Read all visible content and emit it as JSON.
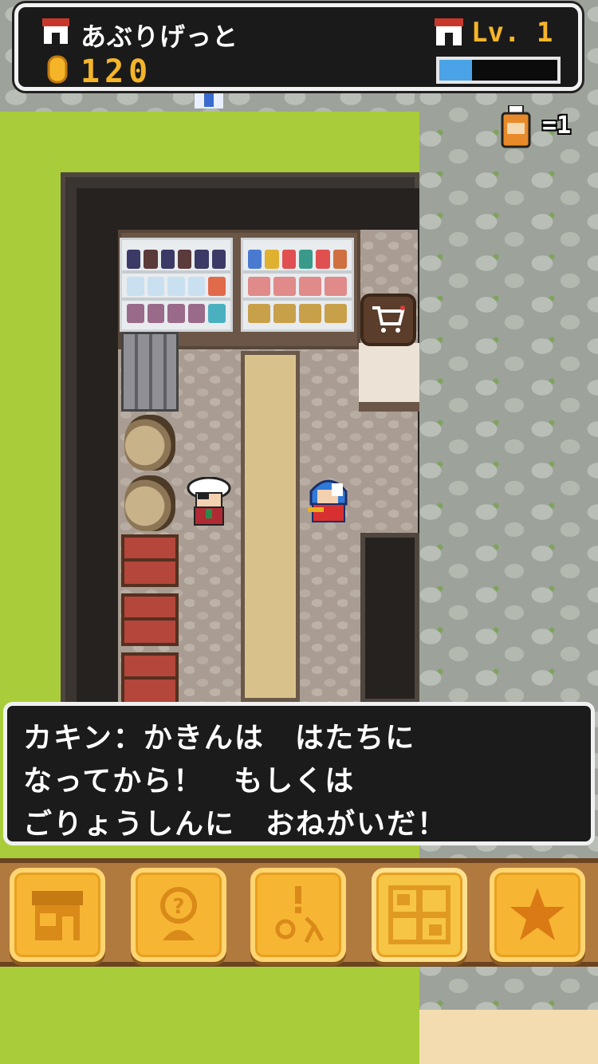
{
  "hud": {
    "player_name": "あぶりげっと",
    "coins": "120",
    "level_label": "Lv. 1",
    "xp_fraction": 0.28
  },
  "inventory": {
    "potion_count": "1"
  },
  "dialog": {
    "text": "カキン：かきんは　はたちに\nなってから！　もしくは\nごりょうしんに　おねがいだ！"
  },
  "menu": {
    "buttons": [
      {
        "icon": "shop-building-icon"
      },
      {
        "icon": "question-scroll-icon"
      },
      {
        "icon": "alert-quest-icon"
      },
      {
        "icon": "town-map-icon",
        "active": true
      },
      {
        "icon": "star-icon"
      }
    ]
  },
  "colors": {
    "accent_gold": "#f5b529",
    "xp_blue": "#4aa3e6",
    "menu_orange": "#f7b534"
  }
}
